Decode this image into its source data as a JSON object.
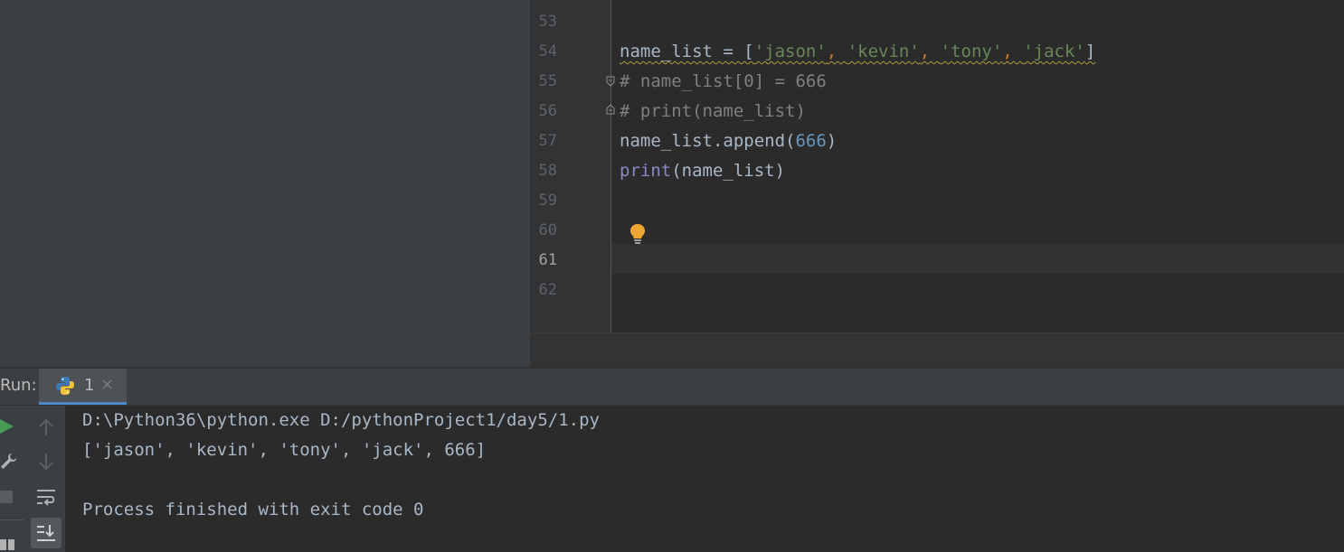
{
  "editor": {
    "line_numbers": [
      "53",
      "54",
      "55",
      "56",
      "57",
      "58",
      "59",
      "60",
      "61",
      "62"
    ],
    "current_line": "61",
    "code": {
      "l54": {
        "var": "name_list = [",
        "s1": "'jason'",
        "c1": ", ",
        "s2": "'kevin'",
        "c2": ", ",
        "s3": "'tony'",
        "c3": ", ",
        "s4": "'jack'",
        "end": "]"
      },
      "l55": "# name_list[0] = 666",
      "l56": "# print(name_list)",
      "l57": {
        "pre": "name_list.append(",
        "num": "666",
        "post": ")"
      },
      "l58": {
        "kw": "print",
        "rest": "(name_list)"
      }
    }
  },
  "run": {
    "label": "Run:",
    "tab_label": "1",
    "tab_close": "×",
    "console": [
      "D:\\Python36\\python.exe D:/pythonProject1/day5/1.py",
      "['jason', 'kevin', 'tony', 'jack', 666]",
      "",
      "Process finished with exit code 0"
    ]
  },
  "icons": [
    "python-icon",
    "run-icon",
    "wrench-icon",
    "stop-icon",
    "layout-icon",
    "up-arrow-icon",
    "down-arrow-icon",
    "soft-wrap-icon",
    "scroll-to-end-icon",
    "fold-icon",
    "lightbulb-icon"
  ],
  "colors": {
    "accent": "#4a88c7",
    "run_green": "#499c54",
    "bulb": "#f0a732"
  }
}
